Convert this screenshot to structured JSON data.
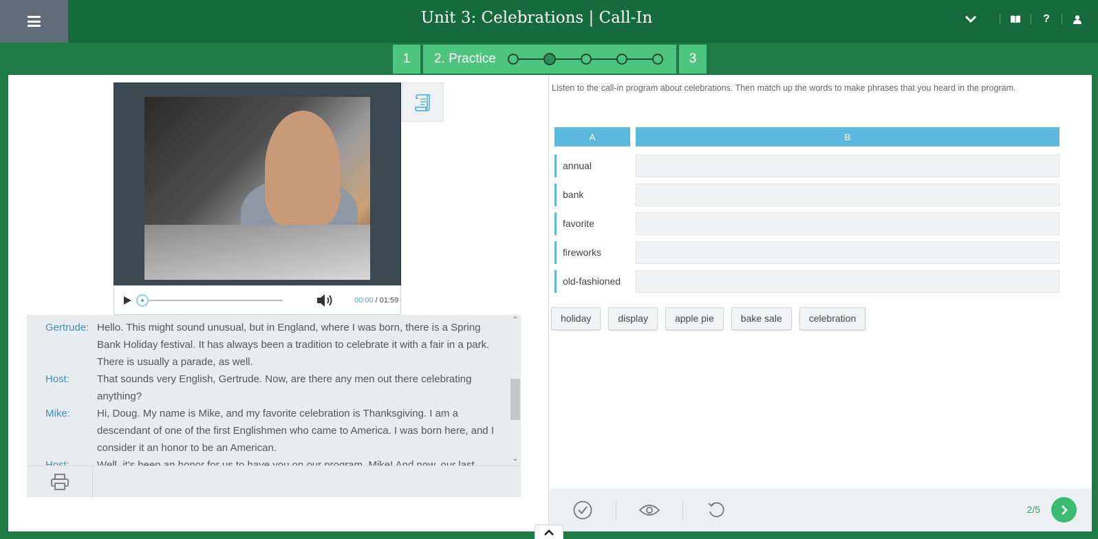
{
  "header": {
    "title": "Unit 3: Celebrations | Call-In",
    "icons": [
      "menu-icon",
      "chevron-down-icon",
      "book-icon",
      "help-icon",
      "user-icon"
    ],
    "help_glyph": "?"
  },
  "steps": {
    "first": "1",
    "active_label": "2. Practice",
    "last": "3",
    "dots_total": 5,
    "dot_current": 2
  },
  "player": {
    "time_current": "00:00",
    "time_total": "/ 01:59",
    "progress": 0
  },
  "transcript": [
    {
      "speaker": "Gertrude:",
      "text": "Hello. This might sound unusual, but in England, where I was born, there is a Spring Bank Holiday festival. It has always been a tradition to celebrate it with a fair in a park. There is usually a parade, as well."
    },
    {
      "speaker": "Host:",
      "text": "That sounds very English, Gertrude. Now, are there any men out there celebrating anything?"
    },
    {
      "speaker": "Mike:",
      "text": "Hi, Doug. My name is Mike, and my favorite celebration is Thanksgiving. I am a descendant of one of the first Englishmen who came to America. I was born here, and I consider it an honor to be an American."
    },
    {
      "speaker": "Host:",
      "text": "Well, it's been an honor for us to have you on our program, Mike! And now, our last"
    }
  ],
  "exercise": {
    "instructions": "Listen to the call-in program about celebrations. Then match up the words to make phrases that you heard in the program.",
    "col_a": "A",
    "col_b": "B",
    "words": [
      "annual",
      "bank",
      "favorite",
      "fireworks",
      "old-fashioned"
    ],
    "options": [
      "holiday",
      "display",
      "apple pie",
      "bake sale",
      "celebration"
    ]
  },
  "footer": {
    "page": "2/5"
  },
  "colors": {
    "brand_green": "#166b3d",
    "step_green": "#4fc380",
    "accent_blue": "#5cb8dc",
    "speaker_blue": "#3f8fbd"
  }
}
